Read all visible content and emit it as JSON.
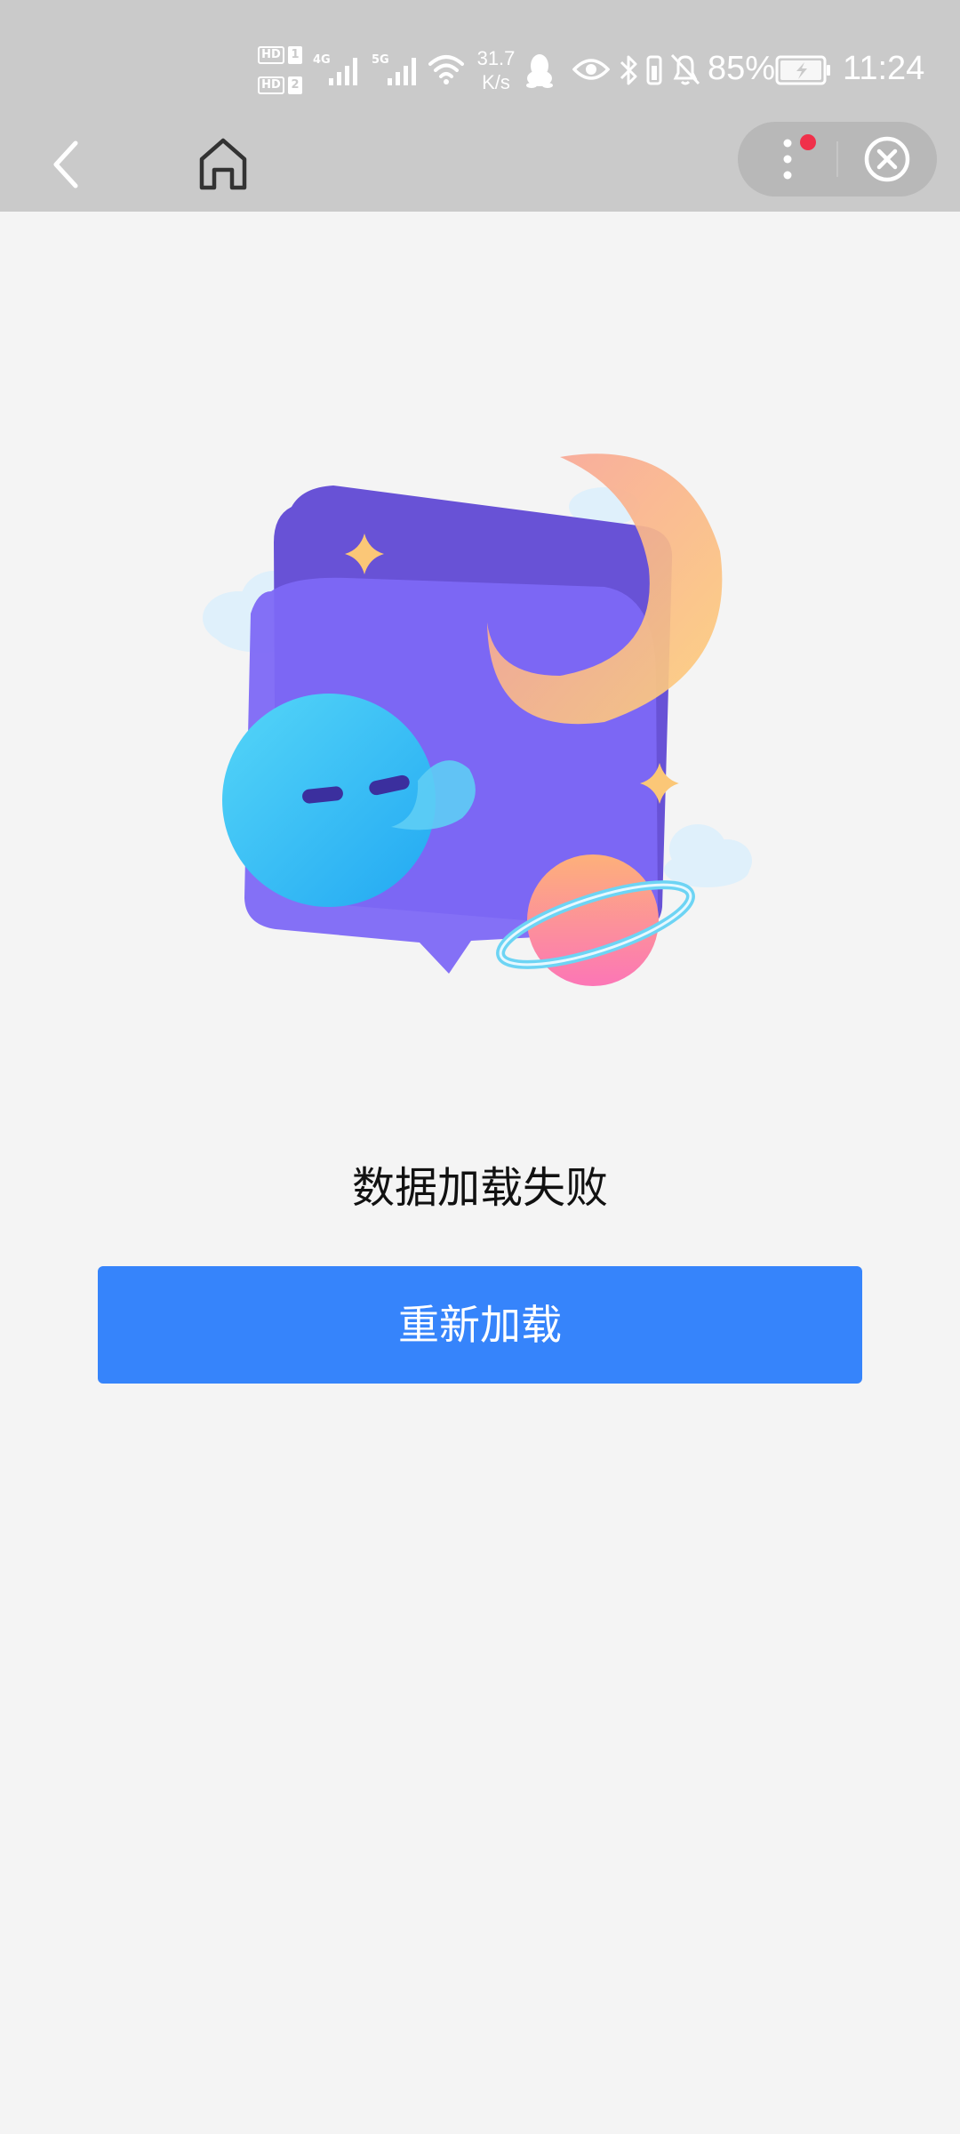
{
  "status_bar": {
    "hd_label": "HD",
    "sim1": "1",
    "sim2": "2",
    "network_4g": "4G",
    "network_5g": "5G",
    "net_speed_value": "31.7",
    "net_speed_unit": "K/s",
    "battery_percent": "85%",
    "time": "11:24",
    "icons": [
      "signal-icon",
      "wifi-icon",
      "qq-icon",
      "eye-icon",
      "bluetooth-icon",
      "vibrate-icon",
      "bell-off-icon",
      "battery-icon"
    ]
  },
  "nav": {
    "icons": [
      "back-icon",
      "home-icon",
      "more-icon",
      "close-icon"
    ],
    "has_notification_dot": true
  },
  "main": {
    "error_message": "数据加载失败",
    "reload_label": "重新加载"
  },
  "colors": {
    "accent": "#3684fb",
    "header_bg": "#cacaca",
    "page_bg": "#f4f4f4",
    "notification_dot": "#f0304a"
  }
}
